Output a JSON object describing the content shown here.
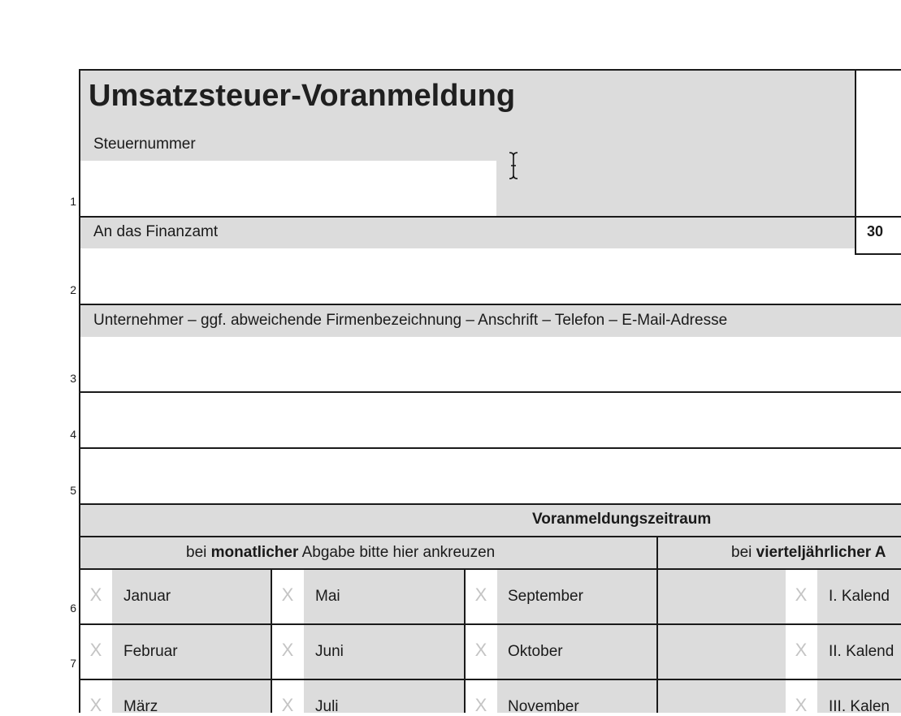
{
  "form": {
    "title": "Umsatzsteuer-Voranmeldung",
    "steuernummer_label": "Steuernummer",
    "steuernummer_value": "",
    "box_number": "30",
    "finanzamt_label": "An das Finanzamt",
    "finanzamt_value": "",
    "unternehmer_label": "Unternehmer – ggf. abweichende Firmenbezeichnung – Anschrift – Telefon – E-Mail-Adresse",
    "line3_value": "",
    "line4_value": "",
    "line5_value": ""
  },
  "row_numbers": [
    "1",
    "2",
    "3",
    "4",
    "5",
    "6",
    "7"
  ],
  "zeitraum": {
    "title": "Voranmeldungszeitraum",
    "monthly_prefix": "bei ",
    "monthly_bold": "monatlicher",
    "monthly_suffix": " Abgabe bitte hier ankreuzen",
    "quarterly_prefix": "bei ",
    "quarterly_bold": "vierteljährlicher A",
    "checkbox_glyph": "X",
    "months_col1": [
      "Januar",
      "Februar",
      "März"
    ],
    "months_col2": [
      "Mai",
      "Juni",
      "Juli"
    ],
    "months_col3": [
      "September",
      "Oktober",
      "November"
    ],
    "quarters": [
      "I. Kalend",
      "II. Kalend",
      "III. Kalen"
    ]
  },
  "colors": {
    "form_gray": "#dcdcdc",
    "border": "#1a1a1a",
    "checkbox_x": "#c4c4c4"
  }
}
